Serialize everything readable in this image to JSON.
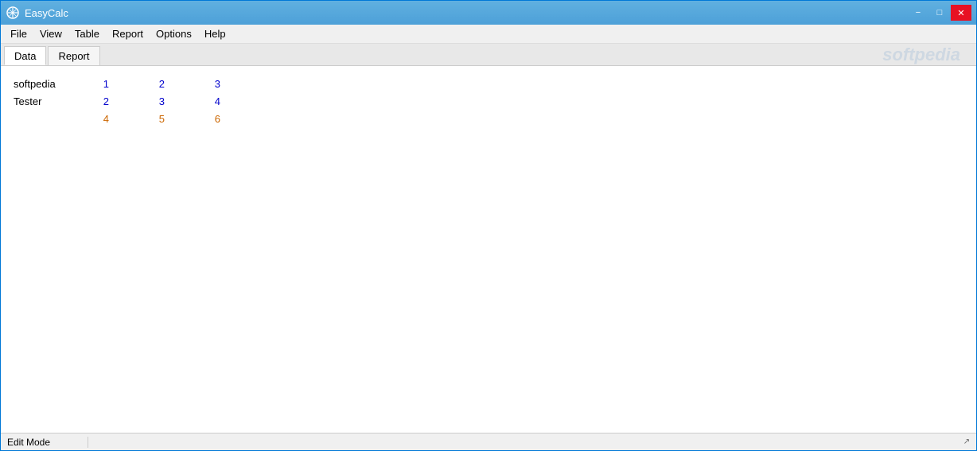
{
  "window": {
    "title": "EasyCalc"
  },
  "titlebar": {
    "minimize_label": "−",
    "restore_label": "□",
    "close_label": "✕"
  },
  "menubar": {
    "items": [
      {
        "label": "File",
        "id": "file"
      },
      {
        "label": "View",
        "id": "view"
      },
      {
        "label": "Table",
        "id": "table"
      },
      {
        "label": "Report",
        "id": "report"
      },
      {
        "label": "Options",
        "id": "options"
      },
      {
        "label": "Help",
        "id": "help"
      }
    ]
  },
  "tabs": [
    {
      "label": "Data",
      "active": true
    },
    {
      "label": "Report",
      "active": false
    }
  ],
  "watermark": "softpedia",
  "table": {
    "rows": [
      {
        "label": "softpedia",
        "col1": "1",
        "col2": "2",
        "col3": "3",
        "col1_color": "blue",
        "col2_color": "blue",
        "col3_color": "blue"
      },
      {
        "label": "Tester",
        "col1": "2",
        "col2": "3",
        "col3": "4",
        "col1_color": "blue",
        "col2_color": "blue",
        "col3_color": "blue"
      },
      {
        "label": "",
        "col1": "4",
        "col2": "5",
        "col3": "6",
        "col1_color": "orange",
        "col2_color": "orange",
        "col3_color": "orange"
      }
    ]
  },
  "statusbar": {
    "mode": "Edit Mode"
  }
}
